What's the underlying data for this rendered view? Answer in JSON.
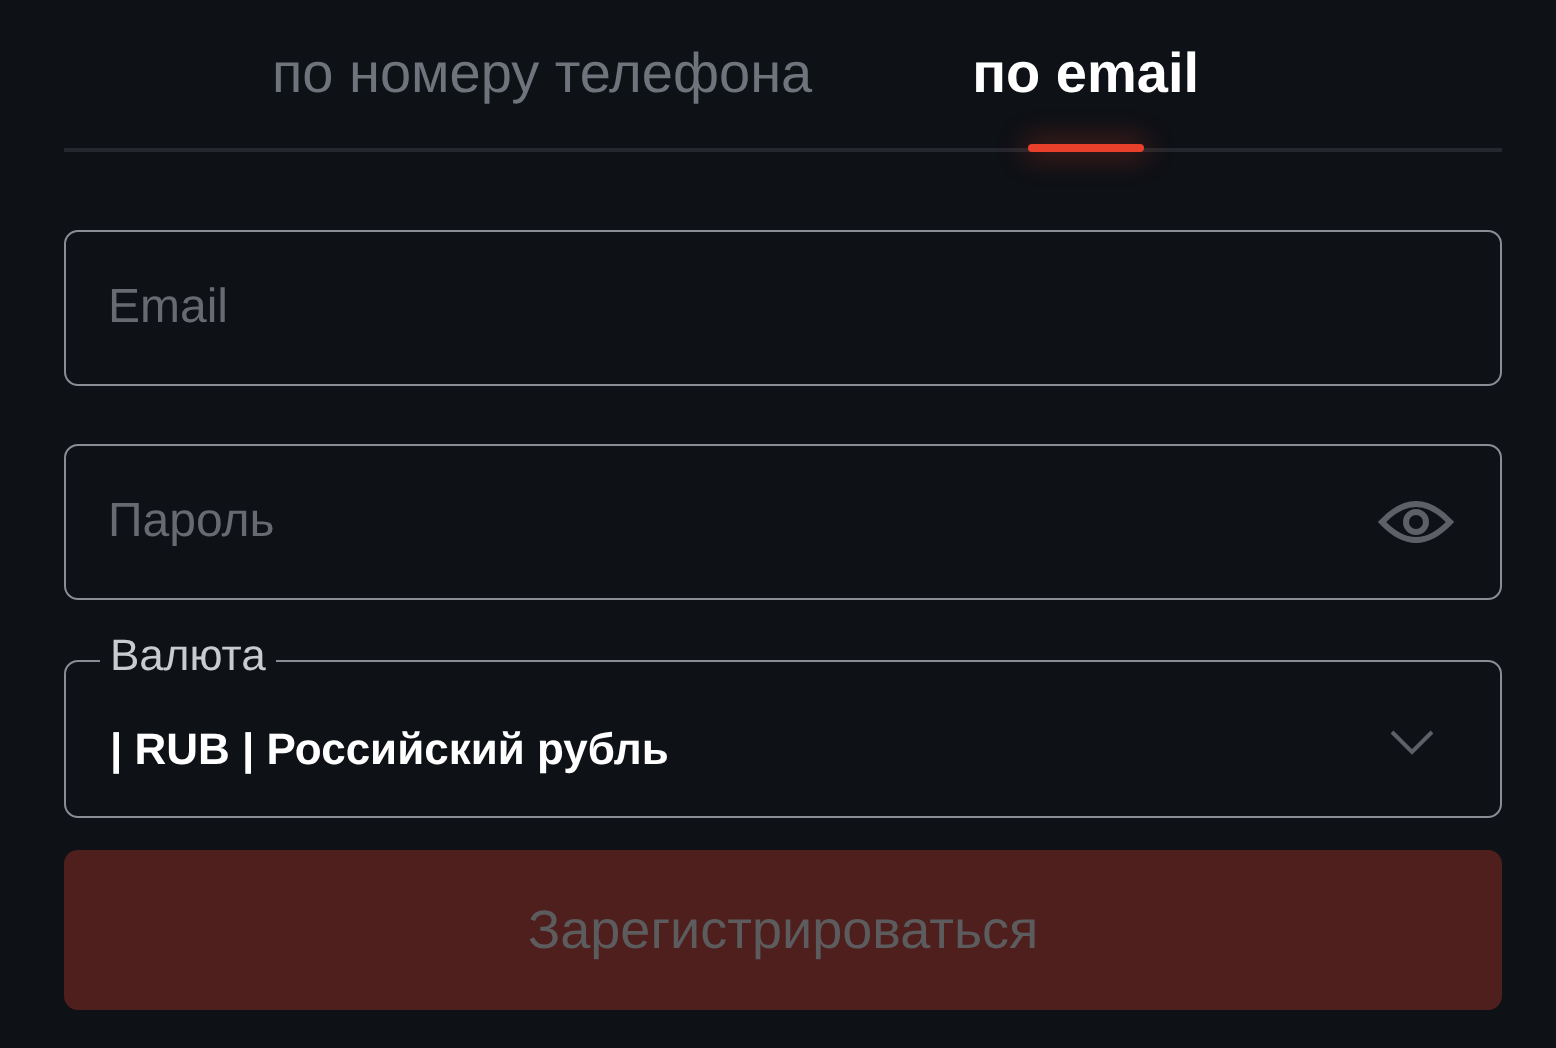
{
  "tabs": [
    {
      "label": "по номеру телефона",
      "selected": false
    },
    {
      "label": "по email",
      "selected": true
    }
  ],
  "email": {
    "placeholder": "Email"
  },
  "password": {
    "placeholder": "Пароль"
  },
  "currency": {
    "label": "Валюта",
    "value": "| RUB | Российский рубль"
  },
  "submit": {
    "label": "Зарегистрироваться",
    "disabled": true
  }
}
